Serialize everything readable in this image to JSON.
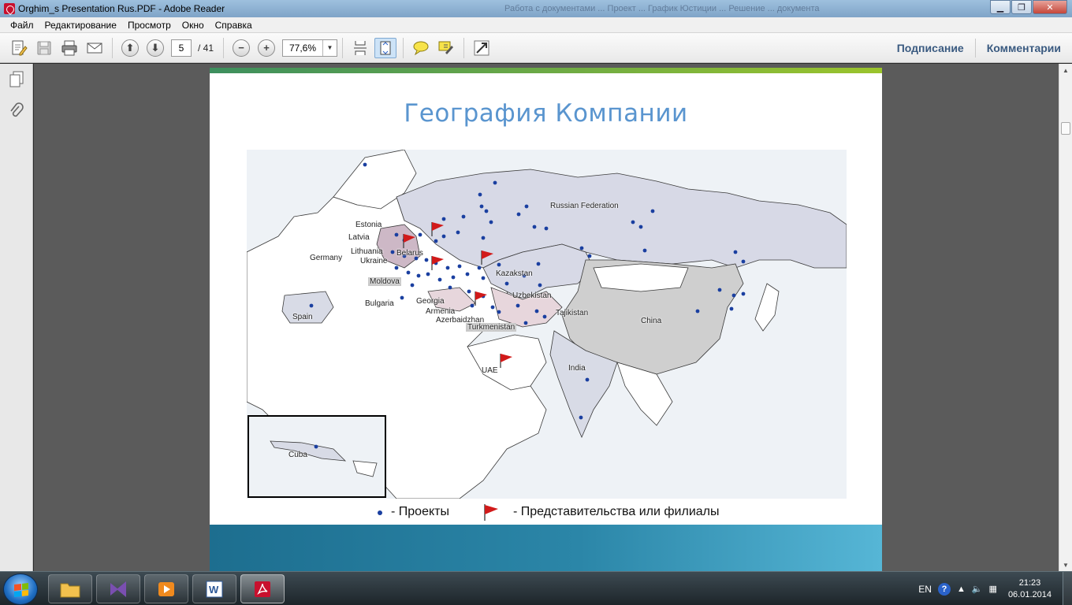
{
  "window": {
    "title": "Orghim_s Presentation Rus.PDF - Adobe Reader",
    "ghost_text": "Работа с документами ... Проект ... График Юстиции ... Решение ... документа"
  },
  "menu": [
    "Файл",
    "Редактирование",
    "Просмотр",
    "Окно",
    "Справка"
  ],
  "toolbar": {
    "page_current": "5",
    "page_total": "/ 41",
    "zoom": "77,6%",
    "sign_label": "Подписание",
    "comment_label": "Комментарии"
  },
  "slide": {
    "title": "География Компании",
    "legend_projects": "- Проекты",
    "legend_offices": "- Представительства или филиалы",
    "colors": {
      "title": "#5a95cf",
      "top_bar": "#9bc42c",
      "bottom_bar": "#1d6e8f",
      "project_dot": "#1a3fa0",
      "flag": "#d11a1a"
    }
  },
  "map": {
    "labels": {
      "russia": "Russian Federation",
      "estonia": "Estonia",
      "latvia": "Latvia",
      "lithuania": "Lithuania",
      "belarus": "Belarus",
      "germany": "Germany",
      "ukraine": "Ukraine",
      "moldova": "Moldova",
      "kazakstan": "Kazakstan",
      "uzbekistan": "Uzbekistan",
      "bulgaria": "Bulgaria",
      "georgia": "Georgia",
      "armenia": "Armenia",
      "azerbaidzhan": "Azerbaidzhan",
      "turkmenistan": "Turkmenistan",
      "tajikistan": "Tajikistan",
      "spain": "Spain",
      "china": "China",
      "uae": "UAE",
      "india": "India",
      "cuba": "Cuba"
    }
  },
  "taskbar": {
    "lang": "EN",
    "time": "21:23",
    "date": "06.01.2014",
    "apps": [
      "explorer",
      "visual-studio",
      "media-player",
      "word",
      "adobe-reader"
    ]
  }
}
